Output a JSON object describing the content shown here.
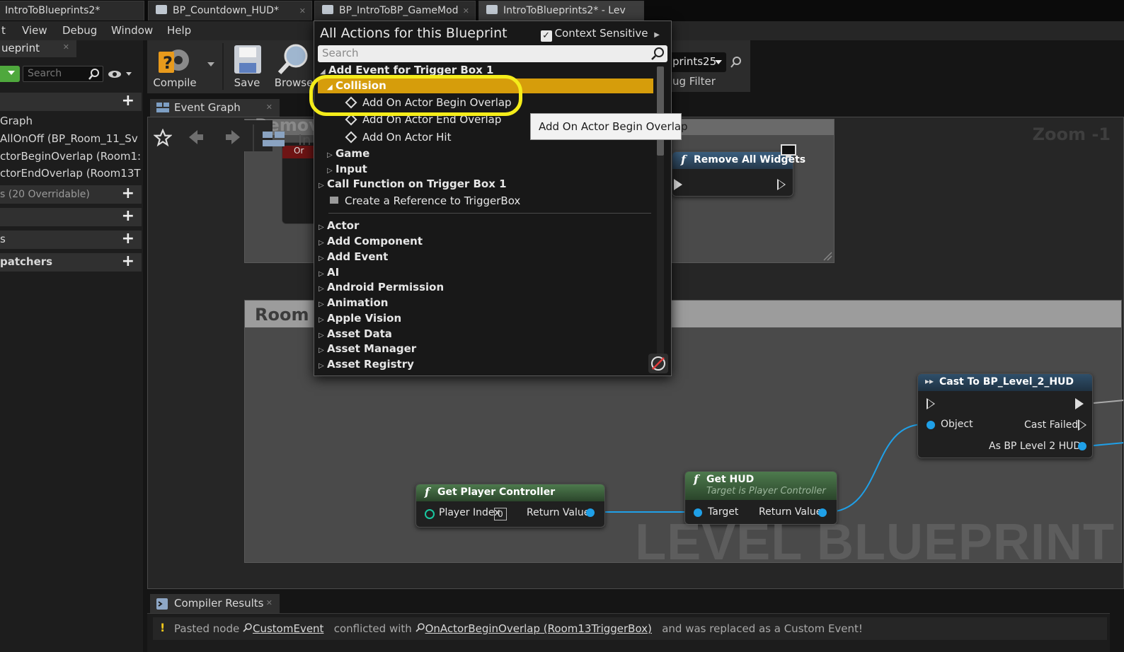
{
  "tabs": [
    {
      "label": "IntroToBlueprints2*"
    },
    {
      "label": "BP_Countdown_HUD*"
    },
    {
      "label": "BP_IntroToBP_GameMod"
    },
    {
      "label": "IntroToBlueprints2* - Lev"
    }
  ],
  "menu": {
    "items": [
      "t",
      "View",
      "Debug",
      "Window",
      "Help"
    ]
  },
  "left_panel": {
    "tab_label": "ueprint",
    "search_placeholder": "Search",
    "items": [
      "Graph",
      "AllOnOff (BP_Room_11_Sv",
      "ctorBeginOverlap (Room1:",
      "ctorEndOverlap (Room13T"
    ],
    "functions_label": "s (20 Overridable)",
    "section_s": "s",
    "dispatchers_label": "patchers"
  },
  "toolbar": {
    "compile_label": "Compile",
    "save_label": "Save",
    "browse_label": "Browse",
    "debug_object": "prints25",
    "debug_filter": "ug Filter"
  },
  "graph": {
    "tab_label": "Event Graph",
    "zoom": "Zoom -1",
    "watermark": "LEVEL BLUEPRINT",
    "comment_room": "Room 1",
    "comment_remove": "Remov",
    "partial_in": "In",
    "partial_on": "Or",
    "nodes": {
      "remove_widgets": {
        "title": "Remove All Widgets"
      },
      "cast": {
        "title": "Cast To BP_Level_2_HUD",
        "object": "Object",
        "cast_failed": "Cast Failed",
        "as_hud": "As BP Level 2 HUD"
      },
      "get_player_controller": {
        "title": "Get Player Controller",
        "player_index": "Player Index",
        "index_value": "0",
        "return_value": "Return Value"
      },
      "get_hud": {
        "title": "Get HUD",
        "subtitle": "Target is Player Controller",
        "target": "Target",
        "return_value": "Return Value"
      }
    }
  },
  "compiler": {
    "tab_label": "Compiler Results",
    "msg_prefix": "Pasted node",
    "node1": "CustomEvent",
    "msg_mid": "conflicted with",
    "node2": "OnActorBeginOverlap (Room13TriggerBox)",
    "msg_suffix": "and was replaced as a Custom Event!"
  },
  "popup": {
    "title": "All Actions for this Blueprint",
    "context_sensitive": "Context Sensitive",
    "search_placeholder": "Search",
    "group_trigger": "Add Event for Trigger Box 1",
    "collision": "Collision",
    "collision_items": [
      "Add On Actor Begin Overlap",
      "Add On Actor End Overlap",
      "Add On Actor Hit"
    ],
    "game": "Game",
    "input": "Input",
    "call_function": "Call Function on Trigger Box 1",
    "create_ref": "Create a Reference to TriggerBox",
    "categories": [
      "Actor",
      "Add Component",
      "Add Event",
      "AI",
      "Android Permission",
      "Animation",
      "Apple Vision",
      "Asset Data",
      "Asset Manager",
      "Asset Registry"
    ]
  },
  "tooltip": "Add On Actor Begin Overlap",
  "colors": {
    "selection": "#d69d0b",
    "highlight": "#f4ec1a",
    "pin_blue": "#1fa0e8",
    "node_green": "#3f6b3f"
  }
}
